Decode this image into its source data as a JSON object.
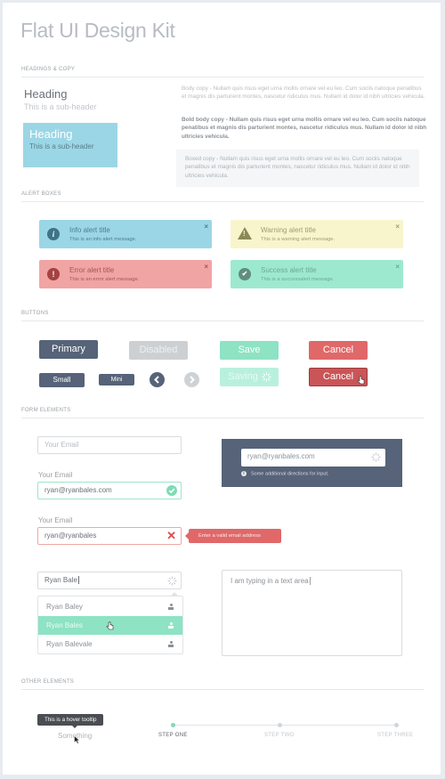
{
  "page": {
    "title": "Flat UI Design Kit"
  },
  "sections": {
    "headings": "HEADINGS & COPY",
    "alerts": "ALERT BOXES",
    "buttons": "BUTTONS",
    "forms": "FORM ELEMENTS",
    "other": "OTHER ELEMENTS"
  },
  "headings": {
    "plain_heading": "Heading",
    "plain_sub": "This is a sub-header",
    "box_heading": "Heading",
    "box_sub": "This is a sub-header",
    "body_copy": "Body copy - Nullam quis risus eget urna mollis ornare vel eu leo. Cum sociis natoque penatibus et magnis dis parturient montes, nascetur ridiculus mus. Nullam id dolor id nibh ultricies vehicula.",
    "bold_copy": "Bold body copy - Nullam quis risus eget urna mollis ornare vel eu leo. Cum sociis natoque penatibus et magnis dis parturient montes, nascetur ridiculus mus. Nullam id dolor id nibh ultricies vehicula.",
    "boxed_copy": "Boxed copy - Nullam quis risus eget urna mollis ornare vel eu leo. Cum sociis natoque penatibus et magnis dis parturient montes, nascetur ridiculus mus. Nullam id dolor id nibh ultricies vehicula."
  },
  "alerts": {
    "info": {
      "title": "Info alert title",
      "message": "This is an info alert message.",
      "icon": "info-icon",
      "glyph": "i",
      "close": "×"
    },
    "warning": {
      "title": "Warning alert title",
      "message": "This is a warning alert message.",
      "icon": "warning-icon",
      "glyph": "!",
      "close": "×"
    },
    "error": {
      "title": "Error alert title",
      "message": "This is an error alert message.",
      "icon": "error-icon",
      "glyph": "!",
      "close": "×"
    },
    "success": {
      "title": "Success alert title",
      "message": "This is a successalert message.",
      "icon": "check-icon",
      "glyph": "✔",
      "close": "×"
    }
  },
  "buttons": {
    "primary": "Primary",
    "disabled": "Disabled",
    "save": "Save",
    "cancel": "Cancel",
    "small": "Small",
    "mini": "Mini",
    "saving": "Saving",
    "cancel_hover": "Cancel"
  },
  "forms": {
    "email_placeholder": "Your Email",
    "email_label": "Your Email",
    "email_valid_value": "ryan@ryanbales.com",
    "email_invalid_label": "Your Email",
    "email_invalid_value": "ryan@ryanbales",
    "error_tip": "Enter a valid email address",
    "dark_input_value": "ryan@ryanbales.com",
    "dark_help": "Some additional directions for input.",
    "autocomplete_value": "Ryan Bale",
    "autocomplete_options": [
      "Ryan Baley",
      "Ryan Bales",
      "Ryan Balevale"
    ],
    "autocomplete_selected": "Ryan Bales",
    "textarea_value": "I am typing in a text area"
  },
  "other": {
    "tooltip": "This is a hover tooltip",
    "tooltip_target": "Something",
    "steps": [
      {
        "label": "STEP ONE",
        "active": true
      },
      {
        "label": "STEP TWO",
        "active": false
      },
      {
        "label": "STEP THREE",
        "active": false
      }
    ]
  },
  "colors": {
    "primary": "#566378",
    "info": "#9bd6e6",
    "warning": "#f8f5cd",
    "error": "#e06869",
    "success": "#8de3c4",
    "disabled": "#cdd0d3"
  }
}
